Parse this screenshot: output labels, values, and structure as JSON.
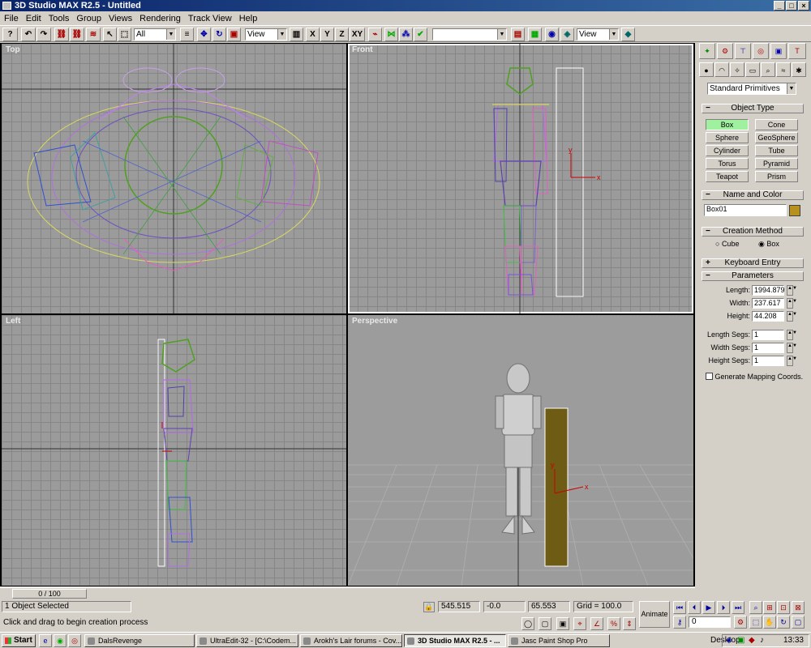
{
  "window": {
    "title": "3D Studio MAX R2.5 - Untitled",
    "min": "_",
    "max": "□",
    "close": "×"
  },
  "menu": [
    "File",
    "Edit",
    "Tools",
    "Group",
    "Views",
    "Rendering",
    "Track View",
    "Help"
  ],
  "toolbar": {
    "selection_filter": "All",
    "ref_coord_1": "View",
    "axis_x": "X",
    "axis_y": "Y",
    "axis_z": "Z",
    "axis_xy": "XY",
    "named_selection": "",
    "ref_coord_2": "View"
  },
  "viewports": {
    "top": "Top",
    "front": "Front",
    "left": "Left",
    "perspective": "Perspective"
  },
  "command_panel": {
    "category": "Standard Primitives",
    "object_type": {
      "header": "Object Type",
      "buttons": [
        "Box",
        "Cone",
        "Sphere",
        "GeoSphere",
        "Cylinder",
        "Tube",
        "Torus",
        "Pyramid",
        "Teapot",
        "Prism"
      ],
      "active": "Box"
    },
    "name_color": {
      "header": "Name and Color",
      "name": "Box01",
      "color": "#b8901e"
    },
    "creation_method": {
      "header": "Creation Method",
      "cube": "Cube",
      "box": "Box",
      "selected": "Box"
    },
    "keyboard_entry": "Keyboard Entry",
    "parameters": {
      "header": "Parameters",
      "length_label": "Length:",
      "length": "1994.879",
      "width_label": "Width:",
      "width": "237.617",
      "height_label": "Height:",
      "height": "44.208",
      "length_segs_label": "Length Segs:",
      "length_segs": "1",
      "width_segs_label": "Width Segs:",
      "width_segs": "1",
      "height_segs_label": "Height Segs:",
      "height_segs": "1",
      "gen_mapping": "Generate Mapping Coords."
    }
  },
  "time_slider": "0 / 100",
  "status": {
    "selected": "1 Object Selected",
    "prompt": "Click and drag to begin creation process",
    "x": "545.515",
    "y": "-0.0",
    "z": "65.553",
    "grid": "Grid = 100.0",
    "animate": "Animate",
    "frame": "0"
  },
  "taskbar": {
    "start": "Start",
    "tasks": [
      "DalsRevenge",
      "UltraEdit-32 - [C:\\Codem...",
      "Arokh's Lair forums - Cov...",
      "3D Studio MAX R2.5 - ...",
      "Jasc Paint Shop Pro"
    ],
    "active_task": "3D Studio MAX R2.5 - ...",
    "desktop": "Desktop",
    "clock": "13:33"
  }
}
